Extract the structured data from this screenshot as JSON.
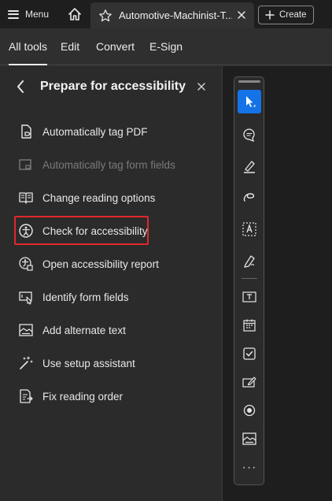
{
  "topbar": {
    "menu_label": "Menu",
    "tab_title": "Automotive-Machinist-T...",
    "create_label": "Create"
  },
  "nav": {
    "items": [
      "All tools",
      "Edit",
      "Convert",
      "E-Sign"
    ],
    "active": "All tools"
  },
  "panel": {
    "title": "Prepare for accessibility",
    "items": [
      {
        "label": "Automatically tag PDF",
        "icon": "tag-pdf-icon",
        "enabled": true
      },
      {
        "label": "Automatically tag form fields",
        "icon": "tag-form-fields-icon",
        "enabled": false
      },
      {
        "label": "Change reading options",
        "icon": "book-icon",
        "enabled": true
      },
      {
        "label": "Check for accessibility",
        "icon": "accessibility-icon",
        "enabled": true,
        "highlighted": true
      },
      {
        "label": "Open accessibility report",
        "icon": "accessibility-report-icon",
        "enabled": true
      },
      {
        "label": "Identify form fields",
        "icon": "form-fields-icon",
        "enabled": true
      },
      {
        "label": "Add alternate text",
        "icon": "alt-text-icon",
        "enabled": true
      },
      {
        "label": "Use setup assistant",
        "icon": "magic-wand-icon",
        "enabled": true
      },
      {
        "label": "Fix reading order",
        "icon": "reading-order-icon",
        "enabled": true
      }
    ]
  },
  "quick_tools": [
    "select-pointer-icon",
    "add-comment-icon",
    "highlight-pen-icon",
    "draw-freehand-icon",
    "text-select-icon",
    "sign-icon",
    "text-field-icon",
    "date-field-icon",
    "checkbox-icon",
    "signature-field-icon",
    "radio-button-icon",
    "image-field-icon"
  ],
  "colors": {
    "accent": "#1473e6",
    "highlight_border": "#e0282c",
    "background": "#2b2b2b"
  }
}
